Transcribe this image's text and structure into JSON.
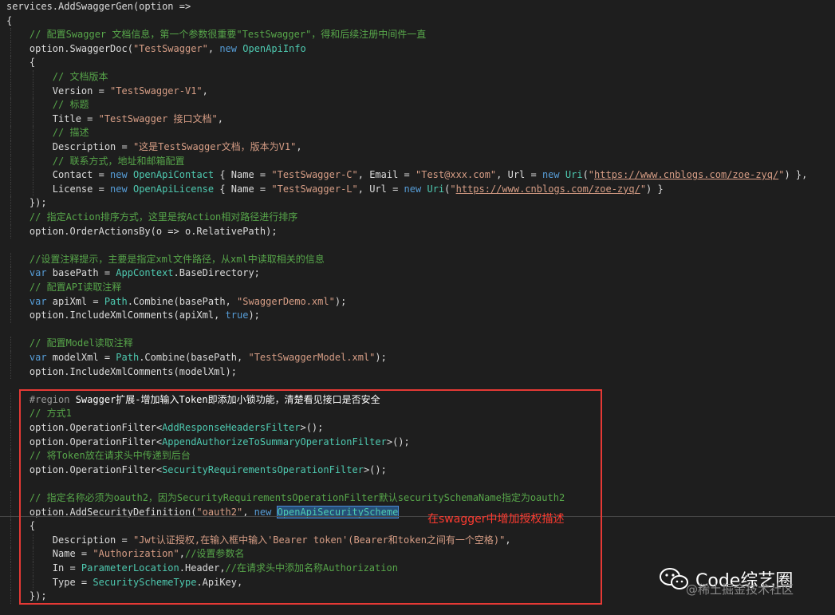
{
  "editor": {
    "lines": [
      [
        [
          "p",
          "services.AddSwaggerGen(option =>"
        ]
      ],
      [
        [
          "p",
          "{"
        ]
      ],
      [
        [
          "c",
          "    // 配置Swagger 文档信息，第一个参数很重要\"TestSwagger\"，得和后续注册中间件一直"
        ]
      ],
      [
        [
          "p",
          "    option.SwaggerDoc("
        ],
        [
          "s",
          "\"TestSwagger\""
        ],
        [
          "p",
          ", "
        ],
        [
          "k",
          "new"
        ],
        [
          "p",
          " "
        ],
        [
          "y",
          "OpenApiInfo"
        ]
      ],
      [
        [
          "p",
          "    {"
        ]
      ],
      [
        [
          "c",
          "        // 文档版本"
        ]
      ],
      [
        [
          "p",
          "        Version = "
        ],
        [
          "s",
          "\"TestSwagger-V1\""
        ],
        [
          "p",
          ","
        ]
      ],
      [
        [
          "c",
          "        // 标题"
        ]
      ],
      [
        [
          "p",
          "        Title = "
        ],
        [
          "s",
          "\"TestSwagger 接口文档\""
        ],
        [
          "p",
          ","
        ]
      ],
      [
        [
          "c",
          "        // 描述"
        ]
      ],
      [
        [
          "p",
          "        Description = "
        ],
        [
          "s",
          "\"这是TestSwagger文档，版本为V1\""
        ],
        [
          "p",
          ","
        ]
      ],
      [
        [
          "c",
          "        // 联系方式，地址和邮箱配置"
        ]
      ],
      [
        [
          "p",
          "        Contact = "
        ],
        [
          "k",
          "new"
        ],
        [
          "p",
          " "
        ],
        [
          "y",
          "OpenApiContact"
        ],
        [
          "p",
          " { Name = "
        ],
        [
          "s",
          "\"TestSwagger-C\""
        ],
        [
          "p",
          ", Email = "
        ],
        [
          "s",
          "\"Test@xxx.com\""
        ],
        [
          "p",
          ", Url = "
        ],
        [
          "k",
          "new"
        ],
        [
          "p",
          " "
        ],
        [
          "y",
          "Uri"
        ],
        [
          "p",
          "("
        ],
        [
          "s",
          "\""
        ],
        [
          "u",
          "https://www.cnblogs.com/zoe-zyq/"
        ],
        [
          "s",
          "\""
        ],
        [
          "p",
          ") },"
        ]
      ],
      [
        [
          "p",
          "        License = "
        ],
        [
          "k",
          "new"
        ],
        [
          "p",
          " "
        ],
        [
          "y",
          "OpenApiLicense"
        ],
        [
          "p",
          " { Name = "
        ],
        [
          "s",
          "\"TestSwagger-L\""
        ],
        [
          "p",
          ", Url = "
        ],
        [
          "k",
          "new"
        ],
        [
          "p",
          " "
        ],
        [
          "y",
          "Uri"
        ],
        [
          "p",
          "("
        ],
        [
          "s",
          "\""
        ],
        [
          "u",
          "https://www.cnblogs.com/zoe-zyq/"
        ],
        [
          "s",
          "\""
        ],
        [
          "p",
          ") }"
        ]
      ],
      [
        [
          "p",
          "    });"
        ]
      ],
      [
        [
          "c",
          "    // 指定Action排序方式，这里是按Action相对路径进行排序"
        ]
      ],
      [
        [
          "p",
          "    option.OrderActionsBy(o => o.RelativePath);"
        ]
      ],
      [],
      [
        [
          "c",
          "    //设置注释提示，主要是指定xml文件路径，从xml中读取相关的信息"
        ]
      ],
      [
        [
          "k",
          "    var"
        ],
        [
          "p",
          " basePath = "
        ],
        [
          "y",
          "AppContext"
        ],
        [
          "p",
          ".BaseDirectory;"
        ]
      ],
      [
        [
          "c",
          "    // 配置API读取注释"
        ]
      ],
      [
        [
          "k",
          "    var"
        ],
        [
          "p",
          " apiXml = "
        ],
        [
          "y",
          "Path"
        ],
        [
          "p",
          ".Combine(basePath, "
        ],
        [
          "s",
          "\"SwaggerDemo.xml\""
        ],
        [
          "p",
          ");"
        ]
      ],
      [
        [
          "p",
          "    option.IncludeXmlComments(apiXml, "
        ],
        [
          "k",
          "true"
        ],
        [
          "p",
          ");"
        ]
      ],
      [],
      [
        [
          "c",
          "    // 配置Model读取注释"
        ]
      ],
      [
        [
          "k",
          "    var"
        ],
        [
          "p",
          " modelXml = "
        ],
        [
          "y",
          "Path"
        ],
        [
          "p",
          ".Combine(basePath, "
        ],
        [
          "s",
          "\"TestSwaggerModel.xml\""
        ],
        [
          "p",
          ");"
        ]
      ],
      [
        [
          "p",
          "    option.IncludeXmlComments(modelXml);"
        ]
      ],
      [],
      [
        [
          "r",
          "    #region"
        ],
        [
          "n",
          " Swagger扩展-增加输入Token即添加小锁功能，清楚看见接口是否安全"
        ]
      ],
      [
        [
          "c",
          "    // 方式1"
        ]
      ],
      [
        [
          "p",
          "    option.OperationFilter<"
        ],
        [
          "y",
          "AddResponseHeadersFilter"
        ],
        [
          "p",
          ">();"
        ]
      ],
      [
        [
          "p",
          "    option.OperationFilter<"
        ],
        [
          "y",
          "AppendAuthorizeToSummaryOperationFilter"
        ],
        [
          "p",
          ">();"
        ]
      ],
      [
        [
          "c",
          "    // 将Token放在请求头中传递到后台"
        ]
      ],
      [
        [
          "p",
          "    option.OperationFilter<"
        ],
        [
          "y",
          "SecurityRequirementsOperationFilter"
        ],
        [
          "p",
          ">();"
        ]
      ],
      [],
      [
        [
          "c",
          "    // 指定名称必须为oauth2，因为SecurityRequirementsOperationFilter默认securitySchemaName指定为oauth2"
        ]
      ],
      [
        [
          "p",
          "    option.AddSecurityDefinition("
        ],
        [
          "s",
          "\"oauth2\""
        ],
        [
          "p",
          ", "
        ],
        [
          "k",
          "new"
        ],
        [
          "p",
          " "
        ],
        [
          "sel",
          "OpenApiSecurityScheme"
        ]
      ],
      [
        [
          "p",
          "    {"
        ]
      ],
      [
        [
          "p",
          "        Description = "
        ],
        [
          "s",
          "\"Jwt认证授权,在输入框中输入'Bearer token'(Bearer和token之间有一个空格)\""
        ],
        [
          "p",
          ","
        ]
      ],
      [
        [
          "p",
          "        Name = "
        ],
        [
          "s",
          "\"Authorization\""
        ],
        [
          "p",
          ","
        ],
        [
          "c",
          "//设置参数名"
        ]
      ],
      [
        [
          "p",
          "        In = "
        ],
        [
          "y",
          "ParameterLocation"
        ],
        [
          "p",
          ".Header,"
        ],
        [
          "c",
          "//在请求头中添加名称Authorization"
        ]
      ],
      [
        [
          "p",
          "        Type = "
        ],
        [
          "y",
          "SecuritySchemeType"
        ],
        [
          "p",
          ".ApiKey,"
        ]
      ],
      [
        [
          "p",
          "    });"
        ]
      ]
    ]
  },
  "annotation": {
    "text": "在swagger中增加授权描述",
    "color": "#ff3b30"
  },
  "watermark": {
    "title": "Code综艺圈",
    "subtitle": "@稀土掘金技术社区"
  },
  "colors": {
    "background": "#1e1e1e",
    "comment": "#57a64a",
    "string": "#d69d85",
    "keyword": "#569cd6",
    "type": "#4ec9b0",
    "box": "#e53935"
  }
}
